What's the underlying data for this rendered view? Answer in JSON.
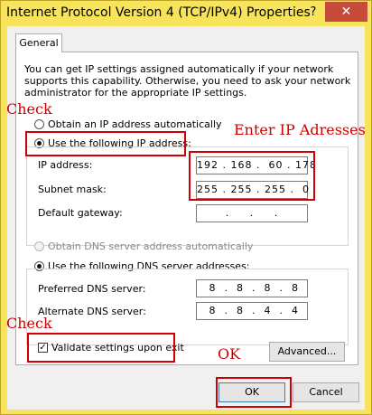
{
  "window": {
    "title": "Internet Protocol Version 4 (TCP/IPv4) Properties",
    "help_label": "?",
    "close_label": "✕"
  },
  "tab": {
    "label": "General"
  },
  "description": "You can get IP settings assigned automatically if your network supports this capability. Otherwise, you need to ask your network administrator for the appropriate IP settings.",
  "ip_mode": {
    "auto_label": "Obtain an IP address automatically",
    "manual_label": "Use the following IP address:",
    "selected": "manual"
  },
  "ip_fields": {
    "ip_address_label": "IP address:",
    "ip_address_value": "192 . 168 .  60 . 178",
    "subnet_label": "Subnet mask:",
    "subnet_value": "255 . 255 . 255 .  0",
    "gateway_label": "Default gateway:",
    "gateway_value": " .     .     . "
  },
  "dns_mode": {
    "auto_label": "Obtain DNS server address automatically",
    "manual_label": "Use the following DNS server addresses:",
    "selected": "manual"
  },
  "dns_fields": {
    "preferred_label": "Preferred DNS server:",
    "preferred_value": " 8  .  8  .  8  .  8",
    "alternate_label": "Alternate DNS server:",
    "alternate_value": " 8  .  8  .  4  .  4"
  },
  "validate": {
    "label": "Validate settings upon exit",
    "checked": true
  },
  "buttons": {
    "advanced": "Advanced...",
    "ok": "OK",
    "cancel": "Cancel"
  },
  "annotations": {
    "check_1": "Check",
    "enter_ip": "Enter IP Adresses",
    "check_2": "Check",
    "ok": "OK"
  },
  "colors": {
    "title_bar": "#f7e45a",
    "close_button": "#c74b3a",
    "annotation": "#d00000"
  }
}
